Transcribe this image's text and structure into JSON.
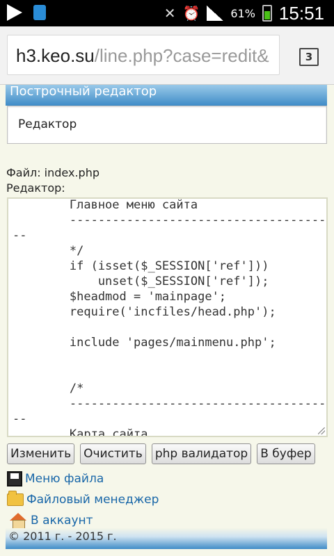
{
  "statusbar": {
    "battery": "61%",
    "time": "15:51"
  },
  "browser": {
    "url_host": "h3.keo.su",
    "url_path": "/line.php?case=redit&",
    "tab_count": "3"
  },
  "page": {
    "header_title": "Построчный редактор",
    "panel_title": "Редактор",
    "file_label": "Файл: index.php",
    "editor_label": "Редактор:",
    "code": "        Главное меню сайта\n        ----------------------------------------------------------------\n--\n        */\n        if (isset($_SESSION['ref']))\n            unset($_SESSION['ref']);\n        $headmod = 'mainpage';\n        require('incfiles/head.php');\n\n        include 'pages/mainmenu.php';\n\n\n        /*\n        ----------------------------------------------------------------\n--\n        Карта сайта",
    "buttons": {
      "edit": "Изменить",
      "clear": "Очистить",
      "php_validator": "php валидатор",
      "buffer": "В буфер"
    },
    "links": {
      "file_menu": "Меню файла",
      "file_manager": "Файловый менеджер",
      "account": "В аккаунт"
    },
    "footer": "© 2011 г. - 2015 г."
  },
  "colors": {
    "header_blue": "#3f8cc7",
    "link_blue": "#1866a8",
    "page_bg": "#f6f7ea"
  }
}
